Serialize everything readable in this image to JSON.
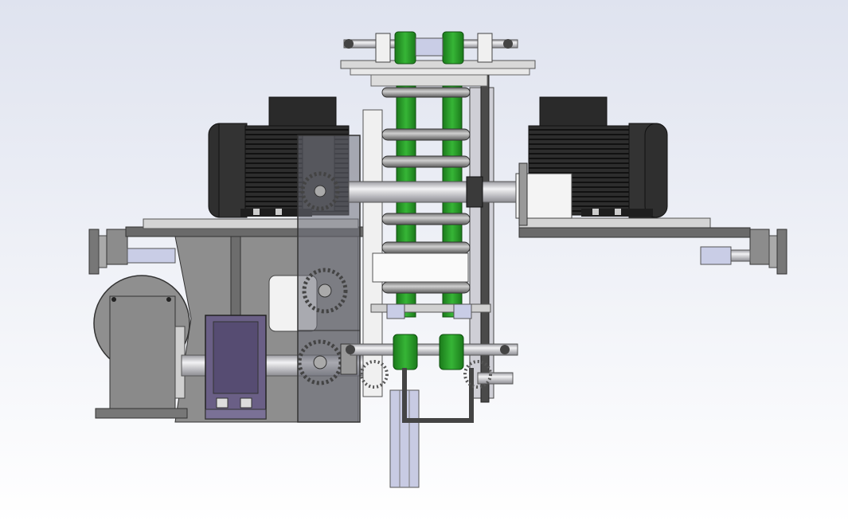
{
  "viewport": {
    "background_top": "#dfe3ef",
    "background_bottom": "#ffffff"
  },
  "colors": {
    "motor_body": "#2e2e2e",
    "motor_fin": "#1c1c1c",
    "frame_gray": "#8a8a8a",
    "frame_light": "#b9b9bd",
    "frame_dark": "#5f5f63",
    "belt_green": "#1f8a1f",
    "belt_green_light": "#2fae2f",
    "guard_tint": "#6d6f7a",
    "coupling_purple": "#6a5f86",
    "shaft_silver": "#e6e8ee",
    "bearing_blue": "#c9cde6",
    "plate_light": "#d8d8d8"
  },
  "components": [
    "left-drive-motor",
    "right-drive-motor",
    "center-conveyor",
    "chain-guard",
    "gear-reducer",
    "coupling-block",
    "idler-carriage",
    "base-frame-left",
    "base-frame-right",
    "support-leg"
  ]
}
